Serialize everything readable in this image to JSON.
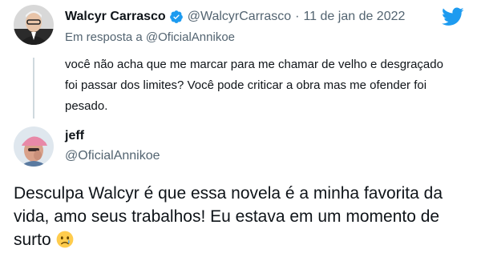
{
  "colors": {
    "text": "#0f1419",
    "secondary": "#536471",
    "twitter_blue": "#1d9bf0",
    "thread_line": "#cfd9de"
  },
  "tweet1": {
    "author_name": "Walcyr Carrasco",
    "verified": true,
    "handle": "@WalcyrCarrasco",
    "separator": "·",
    "date": "11 de jan de 2022",
    "reply_prefix": "Em resposta a",
    "reply_handle": "@OficialAnnikoe",
    "text": "você não acha que me marcar para me chamar de velho e desgraçado foi passar dos limites? Você pode criticar a obra mas me ofender foi pesado."
  },
  "tweet2": {
    "author_name": "jeff",
    "handle": "@OficialAnnikoe",
    "text": "Desculpa Walcyr é que essa novela é a minha favorita da vida, amo seus trabalhos! Eu estava em um momento de surto",
    "emoji": "crying-face"
  },
  "icons": {
    "verified": "verified-badge-icon",
    "brand": "twitter-bird-icon"
  }
}
